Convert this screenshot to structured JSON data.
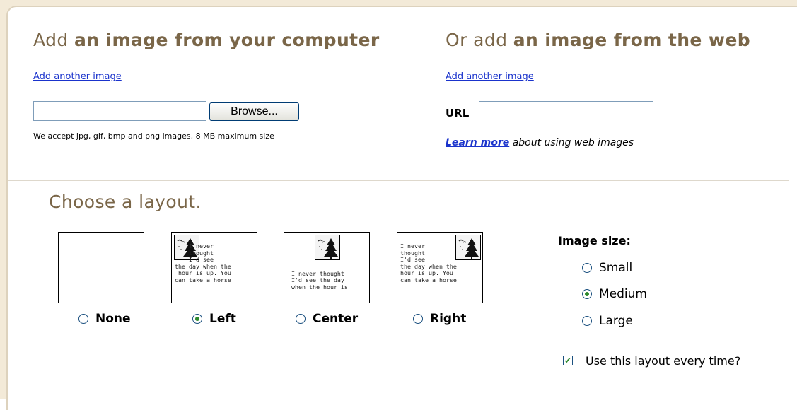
{
  "computer_section": {
    "title_plain": "Add ",
    "title_bold": "an image from your computer",
    "add_link": "Add another image",
    "browse_label": "Browse...",
    "note": "We accept jpg, gif, bmp and png images, 8 MB maximum size",
    "file_value": ""
  },
  "web_section": {
    "title_plain": "Or add ",
    "title_bold": "an image from the web",
    "add_link": "Add another image",
    "url_label": "URL",
    "url_value": "",
    "learn_more_link": "Learn more",
    "learn_more_rest": " about using web images"
  },
  "layout": {
    "title": "Choose a layout.",
    "selected": "Left",
    "options": [
      {
        "label": "None",
        "selected": false
      },
      {
        "label": "Left",
        "selected": true
      },
      {
        "label": "Center",
        "selected": false
      },
      {
        "label": "Right",
        "selected": false
      }
    ],
    "thumb_text": {
      "left": "    I never\n    thought\n    I'd see\nthe day when the\n hour is up. You\ncan take a horse",
      "center": "\n\n\nI never thought\nI'd see the day\nwhen the hour is",
      "right": "I never\nthought\nI'd see\nthe day when the\nhour is up. You\ncan take a horse"
    }
  },
  "image_size": {
    "title": "Image size:",
    "options": [
      {
        "label": "Small",
        "selected": false
      },
      {
        "label": "Medium",
        "selected": true
      },
      {
        "label": "Large",
        "selected": false
      }
    ]
  },
  "remember": {
    "label": "Use this layout every time?",
    "checked": true
  },
  "colors": {
    "heading": "#7a6648",
    "link": "#1a33cc",
    "radio_dot": "#2d8a2d"
  }
}
